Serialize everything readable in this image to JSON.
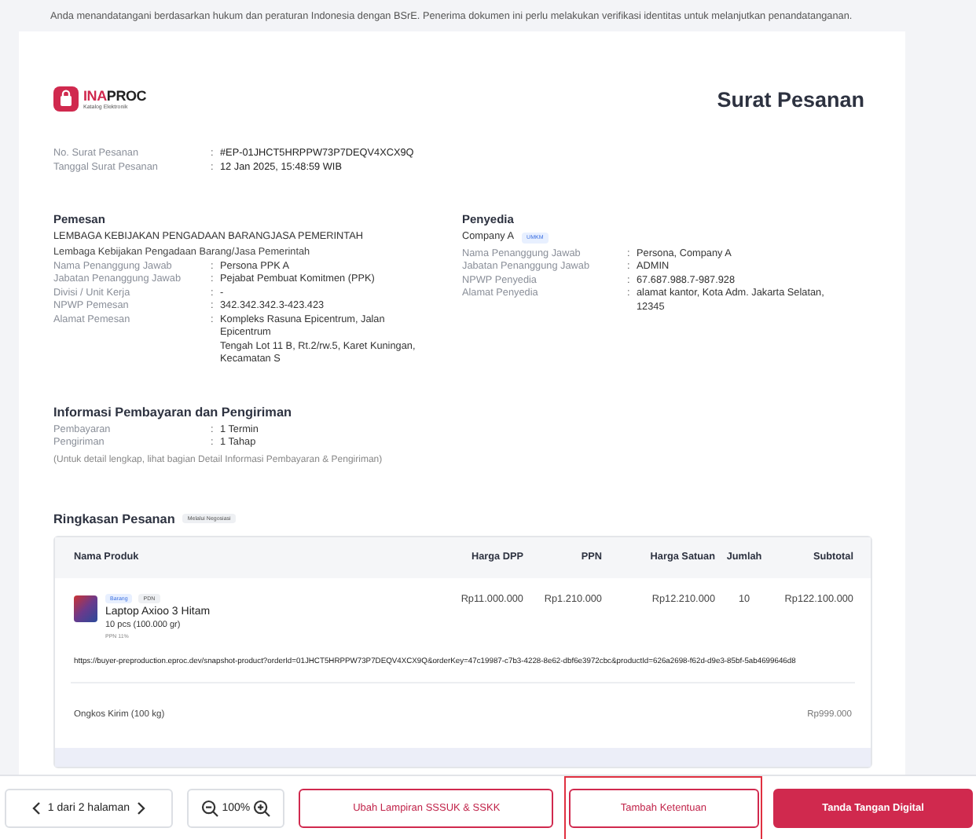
{
  "notice": "Anda menandatangani berdasarkan hukum dan peraturan Indonesia dengan BSrE. Penerima dokumen ini perlu melakukan verifikasi identitas untuk melanjutkan penandatanganan.",
  "document": {
    "logo": {
      "accent": "INA",
      "rest": "PROC",
      "subtitle": "Katalog Elektronik"
    },
    "title": "Surat Pesanan",
    "meta": [
      {
        "label": "No. Surat Pesanan",
        "sep": ":",
        "lines": [
          "#EP-01JHCT5HRPPW73P7DEQV4XCX9Q"
        ]
      },
      {
        "label": "Tanggal Surat Pesanan",
        "sep": ":",
        "lines": [
          "12 Jan 2025, 15:48:59 WIB"
        ]
      }
    ],
    "buyer": {
      "heading": "Pemesan",
      "org_upper": "LEMBAGA KEBIJAKAN PENGADAAN BARANGJASA PEMERINTAH",
      "org": "Lembaga Kebijakan Pengadaan Barang/Jasa Pemerintah",
      "fields": [
        {
          "label": "Nama Penanggung Jawab",
          "sep": ":",
          "lines": [
            "Persona PPK A"
          ]
        },
        {
          "label": "Jabatan Penanggung Jawab",
          "sep": ":",
          "lines": [
            "Pejabat Pembuat Komitmen (PPK)"
          ]
        },
        {
          "label": "Divisi / Unit Kerja",
          "sep": ":",
          "lines": [
            "-"
          ]
        },
        {
          "label": "NPWP Pemesan",
          "sep": ":",
          "lines": [
            "342.342.342.3-423.423"
          ]
        },
        {
          "label": "Alamat Pemesan",
          "sep": ":",
          "lines": [
            "Kompleks Rasuna Epicentrum, Jalan Epicentrum",
            "Tengah Lot 11 B, Rt.2/rw.5, Karet Kuningan, Kecamatan S"
          ]
        }
      ]
    },
    "provider": {
      "heading": "Penyedia",
      "org": "Company A",
      "badge": "UMKM",
      "fields": [
        {
          "label": "Nama Penanggung Jawab",
          "sep": ":",
          "lines": [
            "Persona, Company A"
          ]
        },
        {
          "label": "Jabatan Penanggung Jawab",
          "sep": ":",
          "lines": [
            "ADMIN"
          ]
        },
        {
          "label": "NPWP Penyedia",
          "sep": ":",
          "lines": [
            "67.687.988.7-987.928"
          ]
        },
        {
          "label": "Alamat Penyedia",
          "sep": ":",
          "lines": [
            "alamat kantor, Kota Adm. Jakarta Selatan, 12345"
          ]
        }
      ]
    },
    "payment": {
      "heading": "Informasi Pembayaran dan Pengiriman",
      "fields": [
        {
          "label": "Pembayaran",
          "sep": ":",
          "lines": [
            "1 Termin"
          ]
        },
        {
          "label": "Pengiriman",
          "sep": ":",
          "lines": [
            "1 Tahap"
          ]
        }
      ],
      "note": "(Untuk detail lengkap, lihat bagian Detail Informasi Pembayaran & Pengiriman)"
    },
    "summary": {
      "heading": "Ringkasan Pesanan",
      "badge": "Melalui Negosiasi",
      "columns": [
        "Nama Produk",
        "Harga DPP",
        "PPN",
        "Harga Satuan",
        "Jumlah",
        "Subtotal"
      ],
      "products": [
        {
          "tags": [
            {
              "label": "Barang",
              "kind": "info"
            },
            {
              "label": "PDN",
              "kind": "neutral"
            }
          ],
          "name": "Laptop Axioo 3 Hitam",
          "qty": "10 pcs (100.000 gr)",
          "tax": "PPN 11%",
          "harga_dpp": "Rp11.000.000",
          "ppn": "Rp1.210.000",
          "harga_satuan": "Rp12.210.000",
          "jumlah": "10",
          "subtotal": "Rp122.100.000",
          "url": "https://buyer-preproduction.eproc.dev/snapshot-product?orderId=01JHCT5HRPPW73P7DEQV4XCX9Q&orderKey=47c19987-c7b3-4228-8e62-dbf6e3972cbc&productId=626a2698-f62d-d9e3-85bf-5ab4699646d8"
        }
      ],
      "shipping": {
        "label": "Ongkos Kirim (100 kg)",
        "value": "Rp999.000"
      }
    }
  },
  "footer": {
    "pager": "1 dari 2 halaman",
    "zoom": "100%",
    "buttons": [
      {
        "label": "Ubah Lampiran SSSUK & SSKK",
        "kind": "outline",
        "focused": false
      },
      {
        "label": "Tambah Ketentuan",
        "kind": "outline",
        "focused": true
      },
      {
        "label": "Tanda Tangan Digital",
        "kind": "primary",
        "focused": false
      }
    ]
  }
}
